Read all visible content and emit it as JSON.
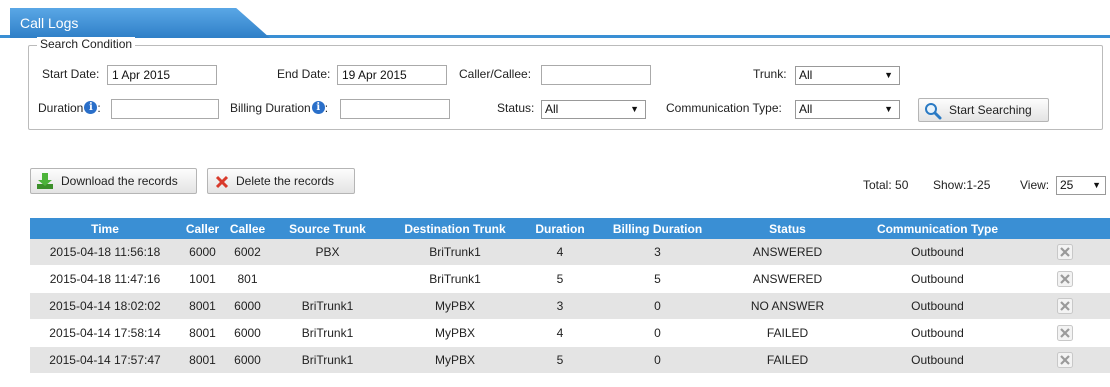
{
  "tab": {
    "title": "Call Logs"
  },
  "search": {
    "legend": "Search Condition",
    "start_date_label": "Start Date:",
    "start_date_value": "1 Apr 2015",
    "end_date_label": "End Date:",
    "end_date_value": "19 Apr 2015",
    "caller_callee_label": "Caller/Callee:",
    "caller_callee_value": "",
    "trunk_label": "Trunk:",
    "trunk_value": "All",
    "duration_label": "Duration",
    "duration_value": "",
    "billing_duration_label": "Billing Duration",
    "billing_duration_value": "",
    "status_label": "Status:",
    "status_value": "All",
    "comm_type_label": "Communication Type:",
    "comm_type_value": "All",
    "start_button": "Start Searching"
  },
  "toolbar": {
    "download_label": "Download the records",
    "delete_label": "Delete the records",
    "total": "Total: 50",
    "show": "Show:1-25",
    "view_label": "View:",
    "view_value": "25"
  },
  "table": {
    "headers": [
      "Time",
      "Caller",
      "Callee",
      "Source Trunk",
      "Destination Trunk",
      "Duration",
      "Billing Duration",
      "Status",
      "Communication Type",
      ""
    ],
    "rows": [
      [
        "2015-04-18 11:56:18",
        "6000",
        "6002",
        "PBX",
        "BriTrunk1",
        "4",
        "3",
        "ANSWERED",
        "Outbound"
      ],
      [
        "2015-04-18 11:47:16",
        "1001",
        "801",
        "",
        "BriTrunk1",
        "5",
        "5",
        "ANSWERED",
        "Outbound"
      ],
      [
        "2015-04-14 18:02:02",
        "8001",
        "6000",
        "BriTrunk1",
        "MyPBX",
        "3",
        "0",
        "NO ANSWER",
        "Outbound"
      ],
      [
        "2015-04-14 17:58:14",
        "8001",
        "6000",
        "BriTrunk1",
        "MyPBX",
        "4",
        "0",
        "FAILED",
        "Outbound"
      ],
      [
        "2015-04-14 17:57:47",
        "8001",
        "6000",
        "BriTrunk1",
        "MyPBX",
        "5",
        "0",
        "FAILED",
        "Outbound"
      ]
    ]
  },
  "colors": {
    "accent": "#3a8fd4",
    "row_alt": "#e4e4e4"
  }
}
